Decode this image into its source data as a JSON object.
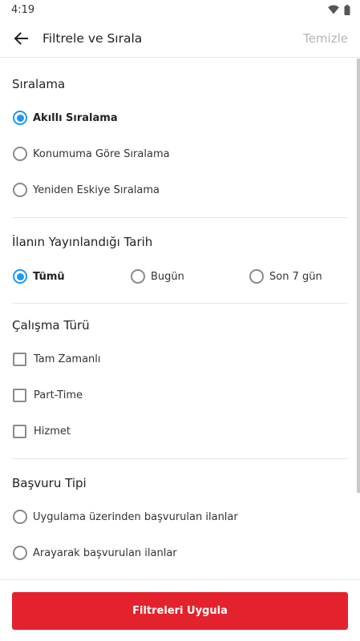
{
  "status_bar": {
    "time": "4:19",
    "icons": [
      "wifi-icon",
      "battery-icon"
    ]
  },
  "app_bar": {
    "back_icon": "arrow-left-icon",
    "title": "Filtrele ve Sırala",
    "clear_label": "Temizle"
  },
  "sorting": {
    "title": "Sıralama",
    "options": [
      {
        "label": "Akıllı Sıralama",
        "selected": true
      },
      {
        "label": "Konumuma Göre Sıralama",
        "selected": false
      },
      {
        "label": "Yeniden Eskiye Sıralama",
        "selected": false
      }
    ]
  },
  "date": {
    "title": "İlanın Yayınlandığı Tarih",
    "options": [
      {
        "label": "Tümü",
        "selected": true
      },
      {
        "label": "Bugün",
        "selected": false
      },
      {
        "label": "Son 7 gün",
        "selected": false
      }
    ]
  },
  "work_type": {
    "title": "Çalışma Türü",
    "options": [
      {
        "label": "Tam Zamanlı",
        "checked": false
      },
      {
        "label": "Part-Time",
        "checked": false
      },
      {
        "label": "Hizmet",
        "checked": false
      }
    ]
  },
  "application": {
    "title": "Başvuru Tipi",
    "options": [
      {
        "label": "Uygulama üzerinden başvurulan ilanlar",
        "selected": false
      },
      {
        "label": "Arayarak başvurulan ilanlar",
        "selected": false
      }
    ]
  },
  "footer": {
    "apply_label": "Filtreleri Uygula"
  },
  "colors": {
    "accent": "#2196f3",
    "primary_button": "#e4222d",
    "clear_text": "#b5b5b5"
  }
}
